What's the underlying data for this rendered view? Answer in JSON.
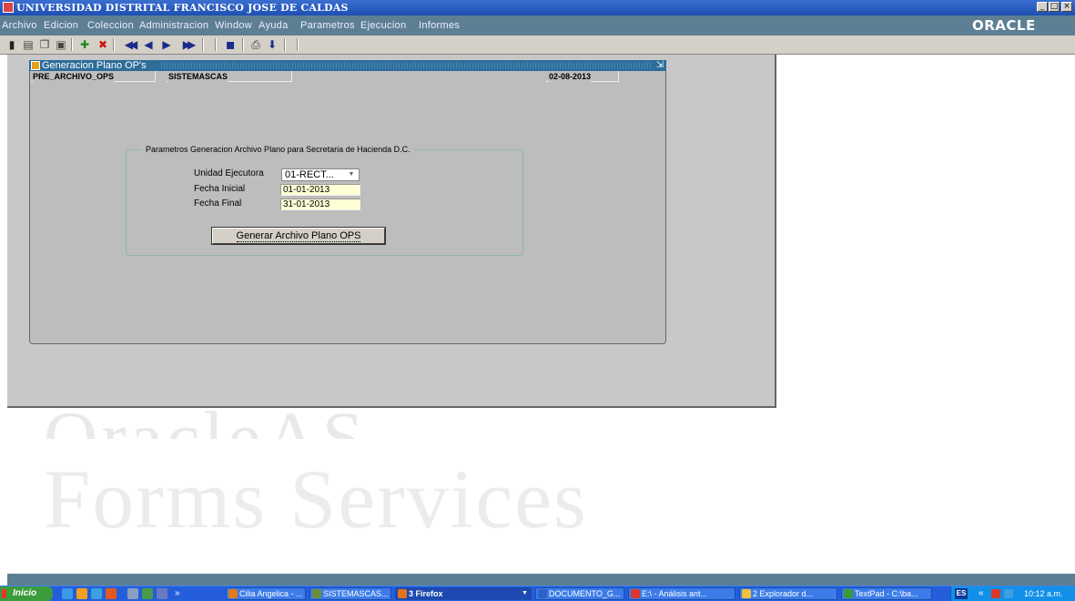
{
  "app": {
    "title": "UNIVERSIDAD DISTRITAL FRANCISCO JOSE DE CALDAS",
    "brand": "ORACLE",
    "window_controls": {
      "minimize": "_",
      "maximize": "□",
      "close": "×"
    }
  },
  "menu": [
    "Archivo",
    "Edicion",
    "Coleccion",
    "Administracion",
    "Window",
    "Ayuda",
    "Parametros",
    "Ejecucion",
    "Informes"
  ],
  "toolbar": [
    {
      "icon": "exit-icon",
      "glyph": "▮"
    },
    {
      "icon": "print-icon",
      "glyph": "▤"
    },
    {
      "icon": "copy-icon",
      "glyph": "❐"
    },
    {
      "icon": "paste-icon",
      "glyph": "▣"
    },
    {
      "icon": "insert-record-icon",
      "glyph": "✚"
    },
    {
      "icon": "delete-record-icon",
      "glyph": "✖"
    },
    {
      "icon": "first-record-icon",
      "glyph": "◀◀"
    },
    {
      "icon": "previous-record-icon",
      "glyph": "◀"
    },
    {
      "icon": "next-record-icon",
      "glyph": "▶"
    },
    {
      "icon": "last-record-icon",
      "glyph": "▶▶"
    },
    {
      "icon": "save-icon",
      "glyph": "▪"
    },
    {
      "icon": "print-preview-icon",
      "glyph": "⎙"
    },
    {
      "icon": "download-icon",
      "glyph": "⬇"
    }
  ],
  "form": {
    "window_title": "Generacion Plano OP's",
    "module": "PRE_ARCHIVO_OPS",
    "user": "SISTEMASCAS",
    "date": "02-08-2013",
    "frame_title": "Parametros Generacion Archivo Plano para Secretaria de Hacienda D.C.",
    "unidad_label": "Unidad Ejecutora",
    "unidad_value": "01-RECT...",
    "fecha_inicial_label": "Fecha Inicial",
    "fecha_inicial_value": "01-01-2013",
    "fecha_final_label": "Fecha Final",
    "fecha_final_value": "31-01-2013",
    "button_label": "Generar Archivo Plano OPS"
  },
  "watermark": {
    "line1": "OracleAS",
    "line2": "Forms Services"
  },
  "taskbar": {
    "start": "Inicio",
    "overflow": "»",
    "tasks": [
      {
        "label": "Cilia Angelica - ...",
        "color": "#e07a1a",
        "active": false
      },
      {
        "label": "SISTEMASCAS...",
        "color": "#6a8e3a",
        "active": false
      },
      {
        "label": "3 Firefox",
        "color": "#e5731b",
        "active": true
      },
      {
        "label": "DOCUMENTO_G...",
        "color": "#2a62c8",
        "active": false
      },
      {
        "label": "E:\\ - Análisis ant...",
        "color": "#d8382e",
        "active": false
      },
      {
        "label": "2 Explorador d...",
        "color": "#f0c33c",
        "active": false
      },
      {
        "label": "TextPad - C:\\ba...",
        "color": "#3a9a3a",
        "active": false
      }
    ],
    "language": "ES",
    "tray_chevron": "«",
    "clock": "10:12 a.m."
  }
}
